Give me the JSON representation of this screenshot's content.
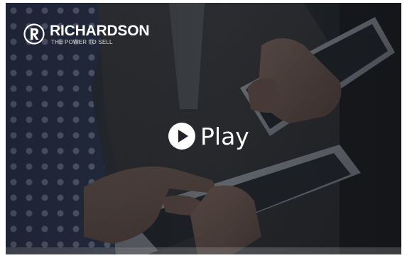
{
  "player": {
    "play_label": "Play",
    "icons": {
      "play": "play-circle-icon",
      "logo": "richardson-r-logo-icon"
    }
  },
  "brand": {
    "name": "RICHARDSON",
    "tagline": "THE POWER TO SELL"
  },
  "colors": {
    "overlay_text": "#ffffff",
    "tagline_text": "#d8d8d8",
    "background_dark": "#1f2228"
  }
}
